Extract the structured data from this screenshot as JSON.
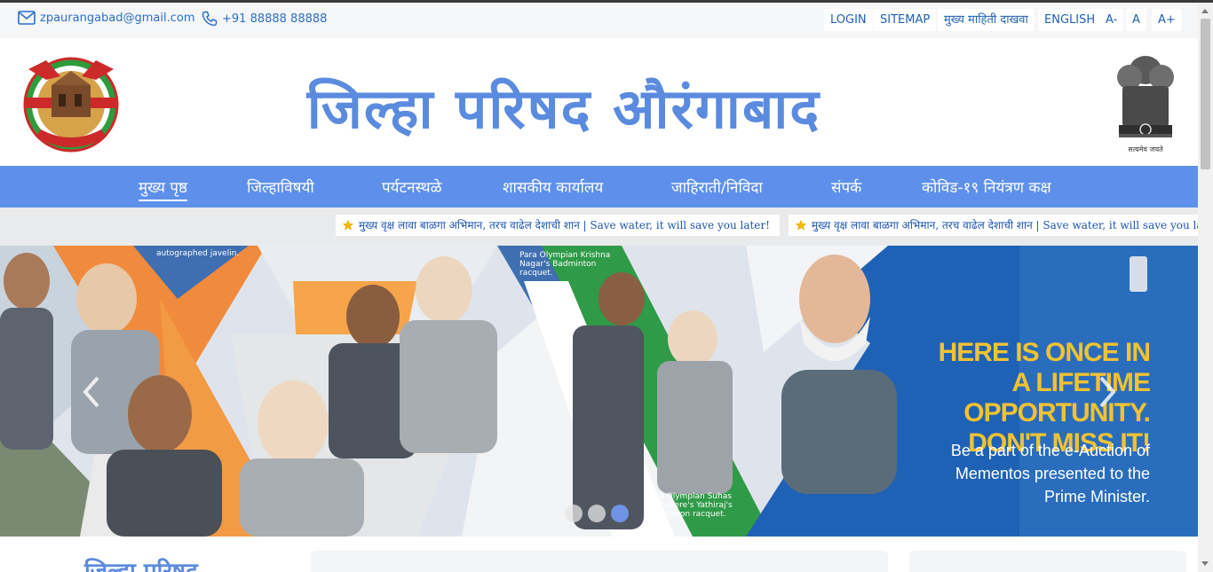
{
  "topbar": {
    "email": "zpaurangabad@gmail.com",
    "phone": "+91 88888 88888",
    "links": [
      "LOGIN",
      "SITEMAP",
      "मुख्य माहिती दाखवा",
      "ENGLISH",
      "A-",
      "A",
      "A+"
    ]
  },
  "header": {
    "title": "जिल्हा परिषद औरंगाबाद",
    "emblem_caption": "सत्यमेव जयते"
  },
  "nav": {
    "items": [
      "मुख्य पृष्ठ",
      "जिल्हाविषयी",
      "पर्यटनस्थळे",
      "शासकीय कार्यालय",
      "जाहिराती/निविदा",
      "संपर्क",
      "कोविड-१९ नियंत्रण कक्ष"
    ]
  },
  "ticker": {
    "text": "मुख्य वृक्ष लावा बाळगा अभिमान, तरच वाढेल देशाची शान | Save water, it will save you later!"
  },
  "banner": {
    "caption_1": "autographed javelin.",
    "caption_2": "Para Olympian Krishna Nagar's Badminton racquet.",
    "caption_3": "Para Olympian Suhas Lalinakere's Yathiraj's Badminton racquet.",
    "headline": "HERE IS ONCE IN A LIFETIME OPPORTUNITY. DON'T MISS IT!",
    "subtext": "Be a part of the e-Auction of Mementos presented to the Prime Minister.",
    "active_slide": 3,
    "slide_count": 3
  },
  "lower": {
    "title": "जिल्हा परिषद"
  },
  "colors": {
    "brand_blue": "#5e90eb",
    "title_blue": "#5b8bde",
    "link_blue": "#1f5fb5",
    "headline_gold": "#f1c232"
  }
}
